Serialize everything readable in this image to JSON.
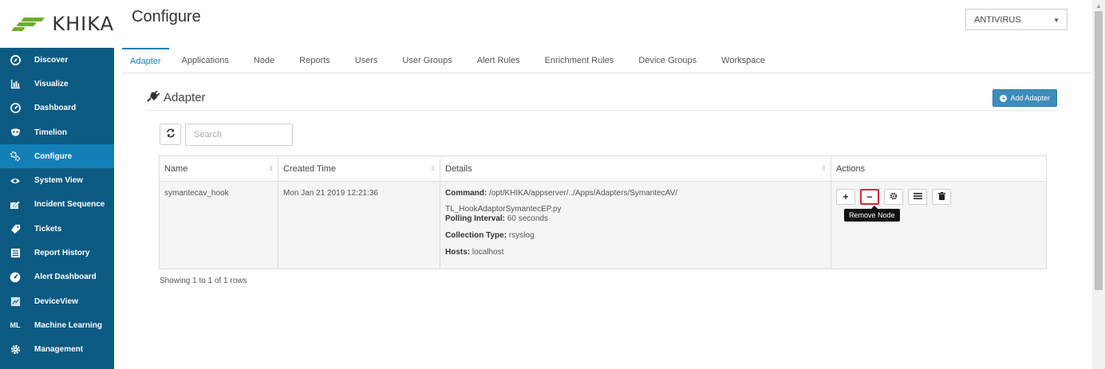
{
  "brand": {
    "name": "KHIKA"
  },
  "sidebar": {
    "items": [
      {
        "label": "Discover",
        "icon": "compass-icon",
        "active": false
      },
      {
        "label": "Visualize",
        "icon": "bar-chart-icon",
        "active": false
      },
      {
        "label": "Dashboard",
        "icon": "gauge-icon",
        "active": false
      },
      {
        "label": "Timelion",
        "icon": "mask-icon",
        "active": false
      },
      {
        "label": "Configure",
        "icon": "gears-icon",
        "active": true
      },
      {
        "label": "System View",
        "icon": "eye-icon",
        "active": false
      },
      {
        "label": "Incident Sequence",
        "icon": "sequence-icon",
        "active": false
      },
      {
        "label": "Tickets",
        "icon": "ticket-icon",
        "active": false
      },
      {
        "label": "Report History",
        "icon": "report-icon",
        "active": false
      },
      {
        "label": "Alert Dashboard",
        "icon": "alert-gauge-icon",
        "active": false
      },
      {
        "label": "DeviceView",
        "icon": "device-icon",
        "active": false
      },
      {
        "label": "Machine Learning",
        "icon": "ml-icon",
        "icon_text": "ML",
        "active": false
      },
      {
        "label": "Management",
        "icon": "cog-icon",
        "active": false
      }
    ]
  },
  "header": {
    "title": "Configure",
    "workspace_select": {
      "value": "ANTIVIRUS"
    }
  },
  "tabs": [
    {
      "label": "Adapter",
      "active": true
    },
    {
      "label": "Applications"
    },
    {
      "label": "Node"
    },
    {
      "label": "Reports"
    },
    {
      "label": "Users"
    },
    {
      "label": "User Groups"
    },
    {
      "label": "Alert Rules"
    },
    {
      "label": "Enrichment Rules"
    },
    {
      "label": "Device Groups"
    },
    {
      "label": "Workspace"
    }
  ],
  "section": {
    "title": "Adapter",
    "add_button": "Add Adapter"
  },
  "search": {
    "placeholder": "Search",
    "value": ""
  },
  "table": {
    "columns": [
      "Name",
      "Created Time",
      "Details",
      "Actions"
    ],
    "rows": [
      {
        "name": "symantecav_hook",
        "created_time": "Mon Jan 21 2019 12:21:36",
        "details": {
          "command_label": "Command:",
          "command_value_1": "/opt/KHIKA/appserver/../Apps/Adapters/SymantecAV/",
          "command_value_2": "TL_HookAdaptorSymantecEP.py",
          "polling_label": "Polling Interval:",
          "polling_value": "60 seconds",
          "collection_label": "Collection Type:",
          "collection_value": "rsyslog",
          "hosts_label": "Hosts:",
          "hosts_value": "localhost"
        },
        "actions": [
          "add-node",
          "remove-node",
          "settings",
          "list",
          "delete"
        ]
      }
    ]
  },
  "tooltip": "Remove Node",
  "footer": "Showing 1 to 1 of 1 rows"
}
